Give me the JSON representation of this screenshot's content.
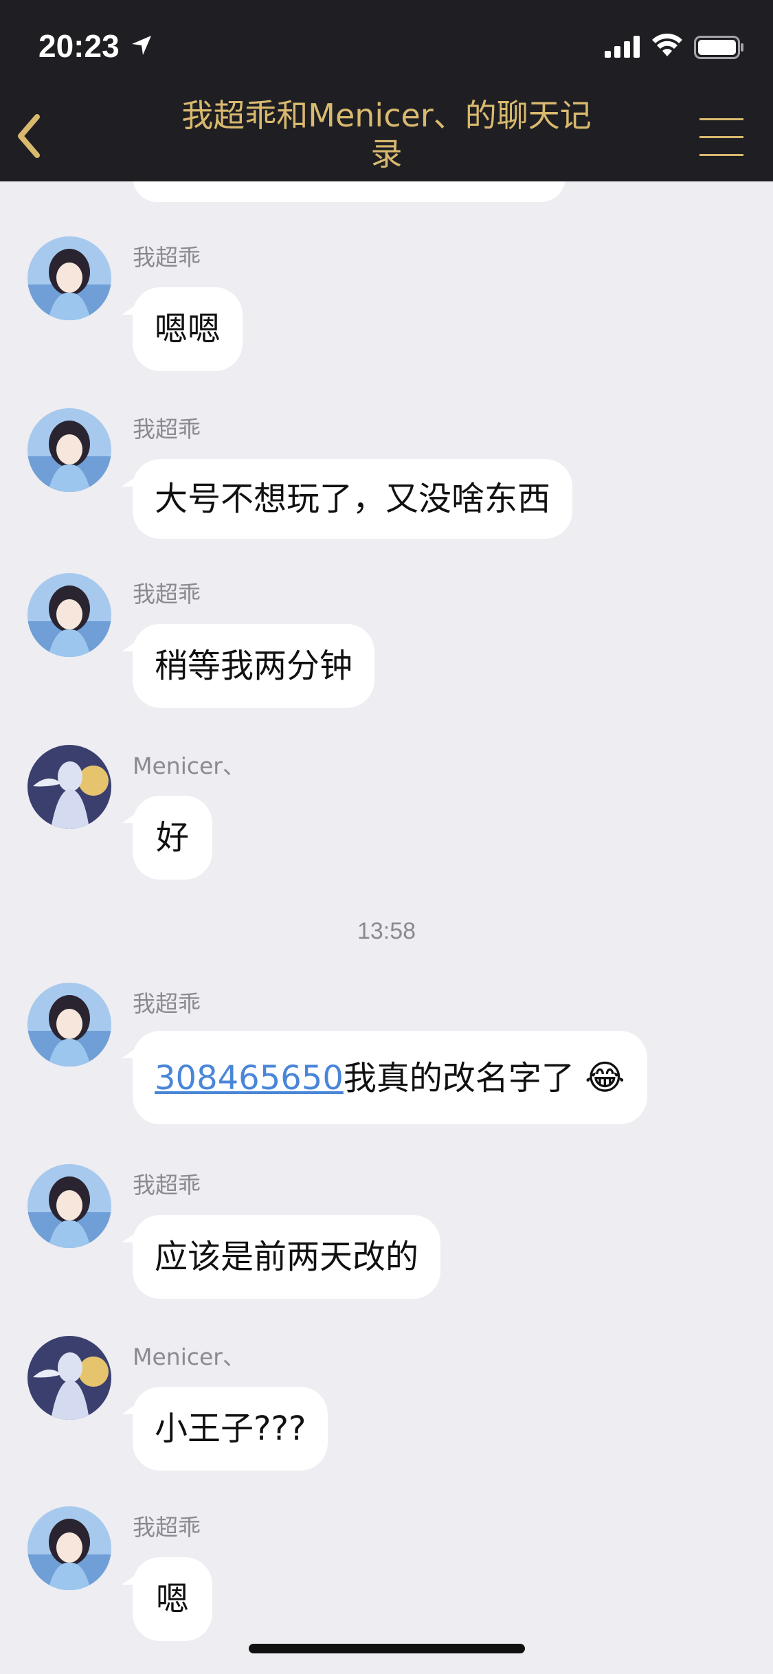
{
  "status_bar": {
    "time": "20:23"
  },
  "nav": {
    "title": "我超乖和Menicer、的聊天记录"
  },
  "chat": {
    "messages": [
      {
        "sender": "我超乖",
        "text": "嗯嗯"
      },
      {
        "sender": "我超乖",
        "text": "大号不想玩了，又没啥东西"
      },
      {
        "sender": "我超乖",
        "text": "稍等我两分钟"
      },
      {
        "sender": "Menicer、",
        "text": "好"
      },
      {
        "sender": "我超乖",
        "link": "308465650",
        "text": "我真的改名字了",
        "emoji": "😂"
      },
      {
        "sender": "我超乖",
        "text": "应该是前两天改的"
      },
      {
        "sender": "Menicer、",
        "text": "小王子???"
      },
      {
        "sender": "我超乖",
        "text": "嗯"
      }
    ],
    "timestamp": "13:58"
  },
  "colors": {
    "nav_bg": "#1F1F23",
    "title_gold": "#D9B96E",
    "chat_bg": "#EDEDF2",
    "link": "#4A86D8"
  },
  "icons": [
    "location-arrow-icon",
    "signal-icon",
    "wifi-icon",
    "battery-icon",
    "back-chevron-icon",
    "menu-icon"
  ]
}
